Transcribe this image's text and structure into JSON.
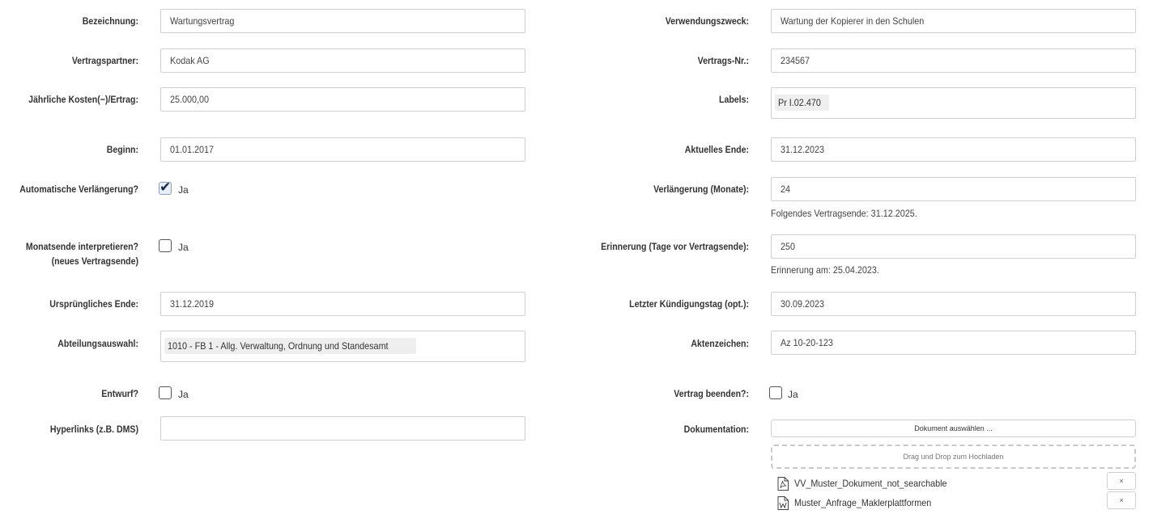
{
  "left": {
    "bezeichnung": {
      "label": "Bezeichnung:",
      "value": "Wartungsvertrag"
    },
    "vertragspartner": {
      "label": "Vertragspartner:",
      "value": "Kodak AG"
    },
    "kosten": {
      "label": "Jährliche Kosten(−)/Ertrag:",
      "value": "25.000,00"
    },
    "beginn": {
      "label": "Beginn:",
      "value": "01.01.2017"
    },
    "auto_verlaengerung": {
      "label": "Automatische Verlängerung?",
      "checked": true,
      "option": "Ja"
    },
    "monatsende": {
      "label_line1": "Monatsende interpretieren?",
      "label_line2": "(neues Vertragsende)",
      "checked": false,
      "option": "Ja"
    },
    "urspruengliches_ende": {
      "label": "Ursprüngliches Ende:",
      "value": "31.12.2019"
    },
    "abteilung": {
      "label": "Abteilungsauswahl:",
      "value": "1010 - FB 1 - Allg. Verwaltung, Ordnung und Standesamt"
    },
    "entwurf": {
      "label": "Entwurf?",
      "checked": false,
      "option": "Ja"
    },
    "hyperlinks": {
      "label": "Hyperlinks (z.B. DMS)",
      "value": ""
    }
  },
  "right": {
    "verwendungszweck": {
      "label": "Verwendungszweck:",
      "value": "Wartung der Kopierer in den Schulen"
    },
    "vertrags_nr": {
      "label": "Vertrags-Nr.:",
      "value": "234567"
    },
    "labels": {
      "label": "Labels:",
      "value": "Pr I.02.470"
    },
    "aktuelles_ende": {
      "label": "Aktuelles Ende:",
      "value": "31.12.2023"
    },
    "verlaengerung_monate": {
      "label": "Verlängerung (Monate):",
      "value": "24",
      "hint": "Folgendes Vertragsende: 31.12.2025."
    },
    "erinnerung": {
      "label": "Erinnerung (Tage vor Vertragsende):",
      "value": "250",
      "hint": "Erinnerung am: 25.04.2023."
    },
    "letzter_kuendigungstag": {
      "label": "Letzter Kündigungstag (opt.):",
      "value": "30.09.2023"
    },
    "aktenzeichen": {
      "label": "Aktenzeichen:",
      "value": "Az 10-20-123"
    },
    "vertrag_beenden": {
      "label": "Vertrag beenden?:",
      "checked": false,
      "option": "Ja"
    },
    "dokumentation": {
      "label": "Dokumentation:",
      "select_button": "Dokument auswählen ...",
      "drop_text": "Drag und Drop zum Hochladen",
      "files": [
        {
          "name": "VV_Muster_Dokument_not_searchable",
          "icon": "pdf-file-icon",
          "remove": "×"
        },
        {
          "name": "Muster_Anfrage_Maklerplattformen",
          "icon": "word-file-icon",
          "remove": "×"
        }
      ]
    }
  }
}
